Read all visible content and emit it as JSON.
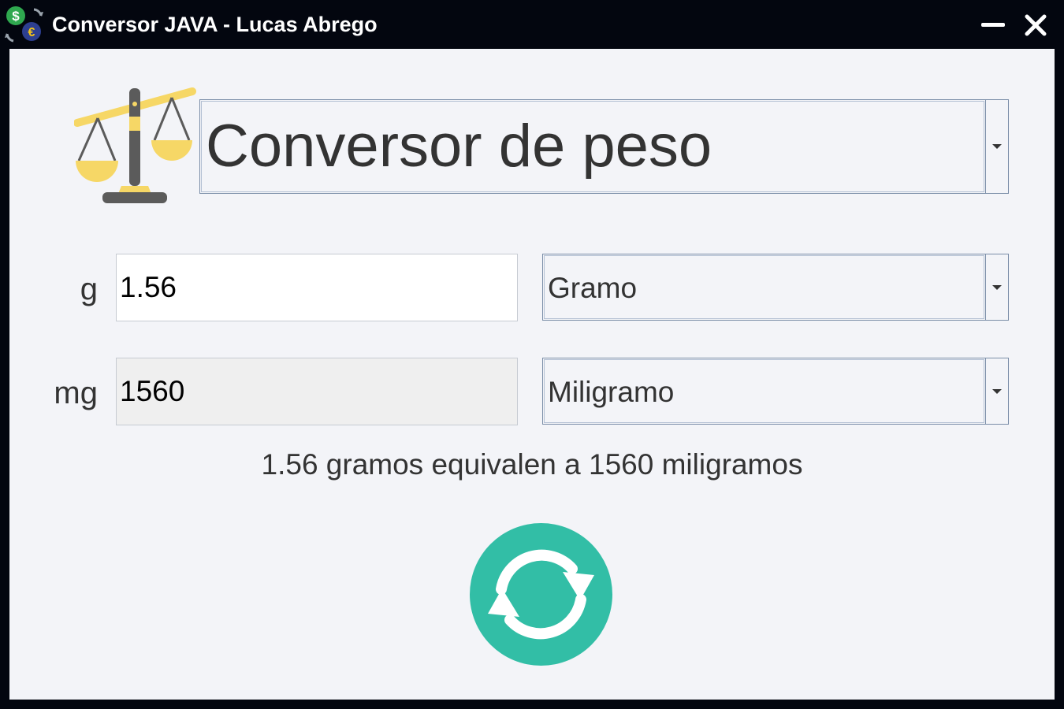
{
  "window": {
    "title": "Conversor JAVA - Lucas Abrego"
  },
  "header": {
    "converter_type": "Conversor de peso"
  },
  "from": {
    "unit_symbol": "g",
    "value": "1.56",
    "unit_name": "Gramo"
  },
  "to": {
    "unit_symbol": "mg",
    "value": "1560",
    "unit_name": "Miligramo"
  },
  "result": {
    "text": "1.56 gramos equivalen a 1560 miligramos"
  },
  "icons": {
    "app": "currency-exchange-icon",
    "converter": "balance-scale-icon",
    "swap": "refresh-icon",
    "minimize": "minimize-icon",
    "close": "close-icon"
  },
  "colors": {
    "titlebar": "#03060f",
    "panel": "#f3f4f8",
    "swap_button": "#32bea6",
    "scale_gold": "#f6d766"
  }
}
